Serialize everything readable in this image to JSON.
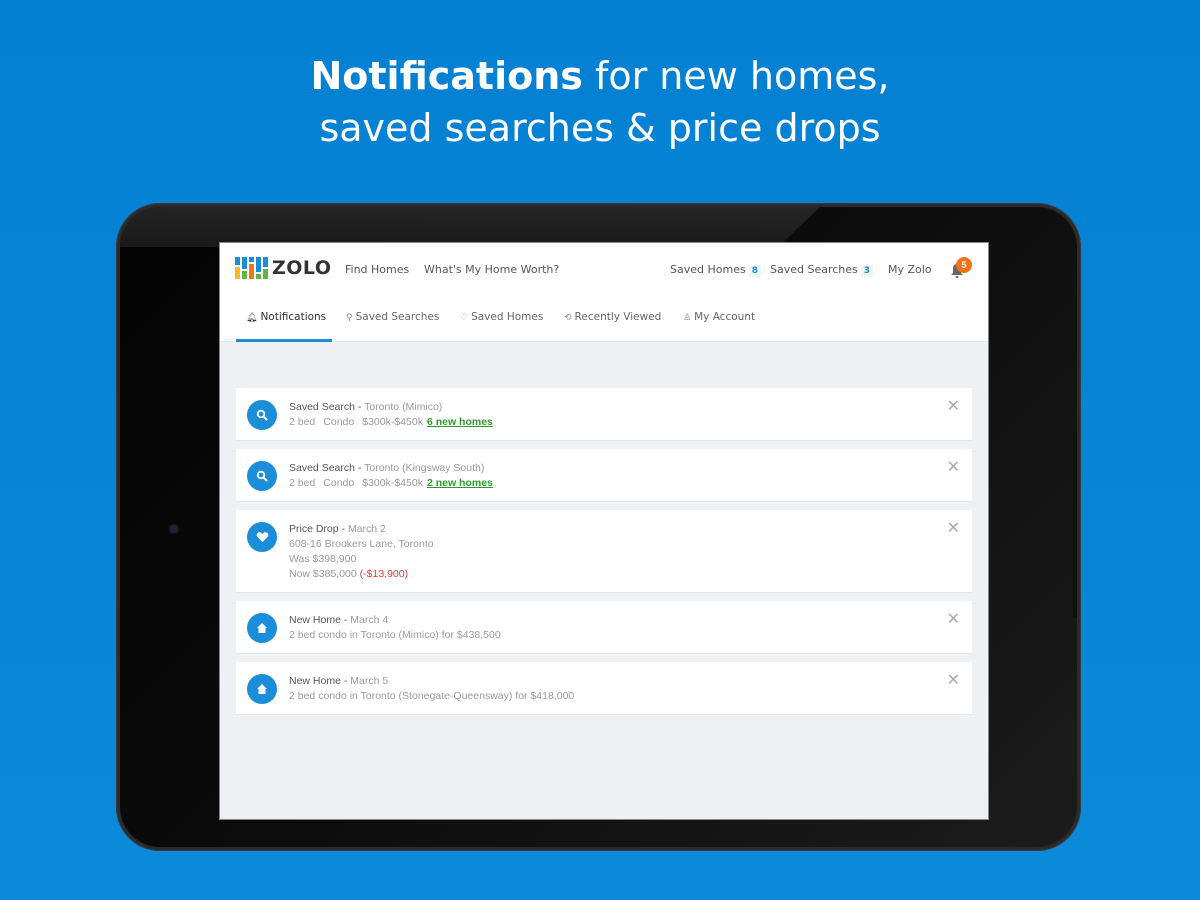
{
  "headline": {
    "bold": "Notifications",
    "rest_line1": " for new homes,",
    "line2": "saved searches & price drops"
  },
  "app": {
    "logo_text": "ZOLO",
    "logo_colors": [
      "#1b8dd9",
      "#f7b924",
      "#5fb446",
      "#f2731c"
    ],
    "topnav": {
      "find_homes": "Find Homes",
      "home_worth": "What's My Home Worth?",
      "saved_homes": "Saved Homes",
      "saved_homes_count": "8",
      "saved_searches": "Saved Searches",
      "saved_searches_count": "3",
      "my_zolo": "My Zolo",
      "notification_count": "5"
    },
    "tabs": [
      {
        "label": "Notifications",
        "icon": "bell-icon",
        "active": true
      },
      {
        "label": "Saved Searches",
        "icon": "saved-search-icon",
        "active": false
      },
      {
        "label": "Saved Homes",
        "icon": "heart-icon",
        "active": false
      },
      {
        "label": "Recently Viewed",
        "icon": "history-icon",
        "active": false
      },
      {
        "label": "My Account",
        "icon": "user-icon",
        "active": false
      }
    ],
    "colors": {
      "accent": "#1b8dd9",
      "badge_orange": "#f2731c",
      "link_green": "#2e9a2e",
      "drop_red": "#e23b3b",
      "background": "#0480d2"
    },
    "notifications": [
      {
        "type": "Saved Search",
        "icon": "search-icon",
        "separator": " - ",
        "meta": "Toronto (Mimico)",
        "beds": "2 bed",
        "kind": "Condo",
        "price_range": "$300k-$450k",
        "link": "6 new homes"
      },
      {
        "type": "Saved Search",
        "icon": "search-icon",
        "separator": " - ",
        "meta": "Toronto (Kingsway South)",
        "beds": "2 bed",
        "kind": "Condo",
        "price_range": "$300k-$450k",
        "link": "2 new homes"
      },
      {
        "type": "Price Drop",
        "icon": "heart-icon",
        "separator": " - ",
        "meta": "March 2",
        "address": "608-16 Brookers Lane, Toronto",
        "was": "Was $398,900",
        "now": "Now $385,000",
        "delta": "(-$13,900)"
      },
      {
        "type": "New Home",
        "icon": "home-icon",
        "separator": " - ",
        "meta": "March 4",
        "desc": "2 bed condo in Toronto (Mimico) for $438,500"
      },
      {
        "type": "New Home",
        "icon": "home-icon",
        "separator": " - ",
        "meta": "March 5",
        "desc": "2 bed condo in Toronto (Stonegate-Queensway) for $418,000"
      }
    ],
    "close_glyph": "✕"
  }
}
